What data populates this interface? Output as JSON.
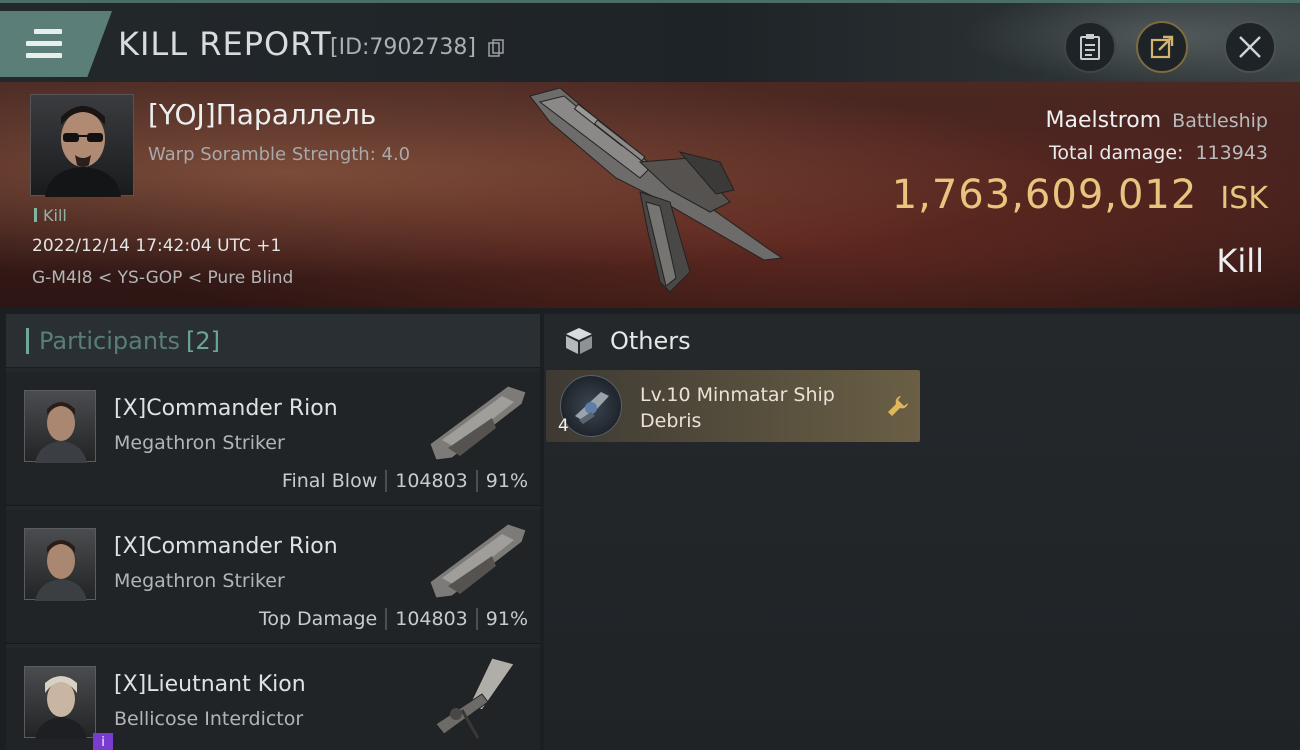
{
  "header": {
    "title": "KILL REPORT",
    "report_id": "[ID:7902738]"
  },
  "victim": {
    "name": "[YOJ]Параллель",
    "subtitle": "Warp Soramble Strength: 4.0",
    "tag": "Kill",
    "datetime": "2022/12/14 17:42:04 UTC +1",
    "location": "G-M4I8 < YS-GOP < Pure Blind",
    "ship_name": "Maelstrom",
    "ship_class": "Battleship",
    "total_damage_label": "Total damage:",
    "total_damage": "113943",
    "isk_value": "1,763,609,012",
    "isk_unit": "ISK",
    "result": "Kill"
  },
  "participants": {
    "label": "Participants",
    "count": "[2]",
    "rows": [
      {
        "name": "[X]Commander Rion",
        "ship": "Megathron Striker",
        "role": "Final Blow",
        "damage": "104803",
        "percent": "91%"
      },
      {
        "name": "[X]Commander Rion",
        "ship": "Megathron Striker",
        "role": "Top Damage",
        "damage": "104803",
        "percent": "91%"
      },
      {
        "name": "[X]Lieutnant Kion",
        "ship": "Bellicose Interdictor",
        "badge": "i"
      }
    ]
  },
  "others": {
    "label": "Others",
    "items": [
      {
        "name": "Lv.10 Minmatar Ship Debris",
        "qty": "4"
      }
    ]
  },
  "colors": {
    "accent_teal": "#6fa89a",
    "isk_gold": "#e8c57e",
    "loot_gold": "#6a5f45",
    "pilot_badge": "#7a3bd0"
  }
}
